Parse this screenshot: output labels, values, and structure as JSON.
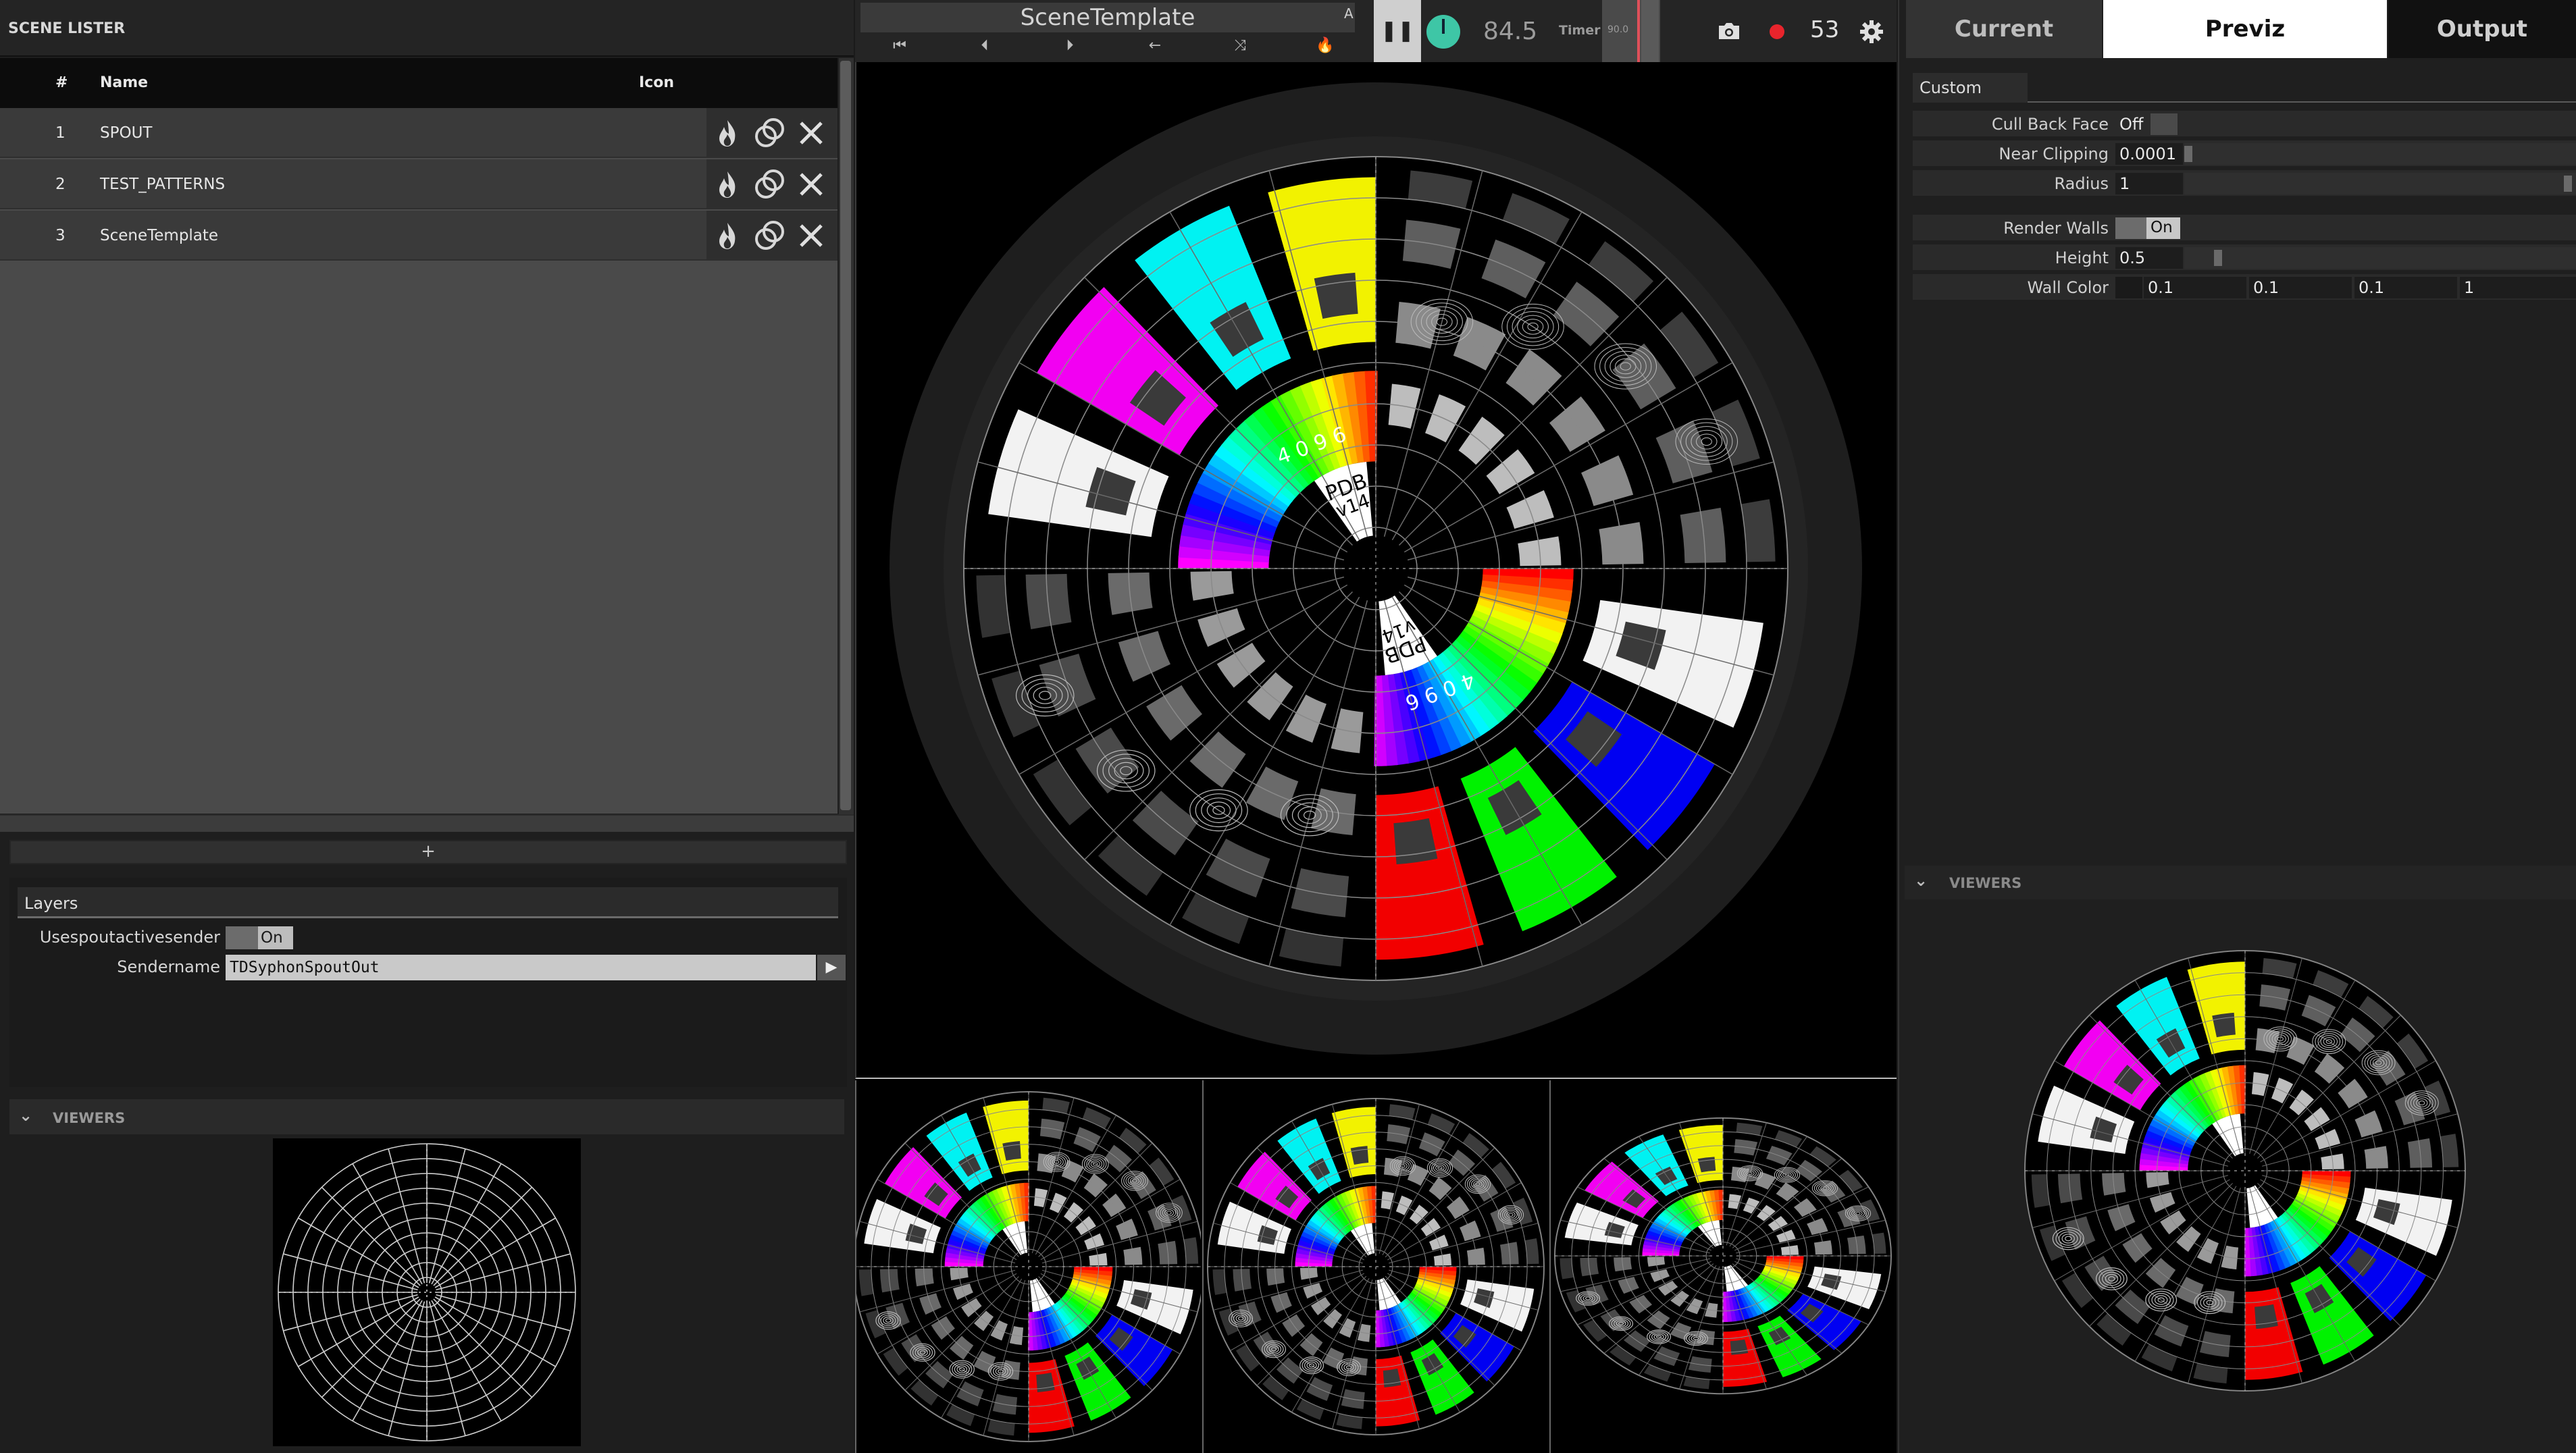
{
  "lister": {
    "title": "SCENE LISTER",
    "columns": {
      "num": "#",
      "name": "Name",
      "icon": "Icon"
    },
    "scenes": [
      {
        "num": "1",
        "name": "SPOUT"
      },
      {
        "num": "2",
        "name": "TEST_PATTERNS"
      },
      {
        "num": "3",
        "name": "SceneTemplate"
      }
    ],
    "add_label": "+"
  },
  "layers": {
    "tab": "Layers",
    "use_spout_label": "Usespoutactivesender",
    "use_spout_value": "On",
    "sender_label": "Sendername",
    "sender_value": "TDSyphonSpoutOut",
    "sender_go": "▶"
  },
  "left_viewers": {
    "label": "VIEWERS"
  },
  "transport": {
    "component": "SceneTemplate",
    "a_label": "A",
    "fps": "84.5",
    "timer_label": "Timer",
    "timer_value": "90.0",
    "record_count": "53",
    "buttons": [
      "⏮",
      "⏴",
      "⏵",
      "←",
      "⤨",
      "🔥"
    ]
  },
  "right": {
    "tabs": [
      "Current",
      "Previz",
      "Output"
    ],
    "active_tab": "Previz",
    "custom_tab": "Custom",
    "params": {
      "cull_label": "Cull Back Face",
      "cull_value": "Off",
      "near_label": "Near Clipping",
      "near_value": "0.0001",
      "radius_label": "Radius",
      "radius_value": "1",
      "walls_label": "Render Walls",
      "walls_value": "On",
      "height_label": "Height",
      "height_value": "0.5",
      "wallcolor_label": "Wall Color",
      "wallcolor_values": [
        "0.1",
        "0.1",
        "0.1",
        "1"
      ]
    },
    "viewers_label": "VIEWERS"
  },
  "chart_pattern": {
    "rings": 10,
    "labels": [
      "PDB",
      "v14",
      "4096"
    ]
  },
  "colors": {
    "accent_teal": "#3ec6a6",
    "record_red": "#e8242c",
    "timer_marker": "#e0505a"
  }
}
